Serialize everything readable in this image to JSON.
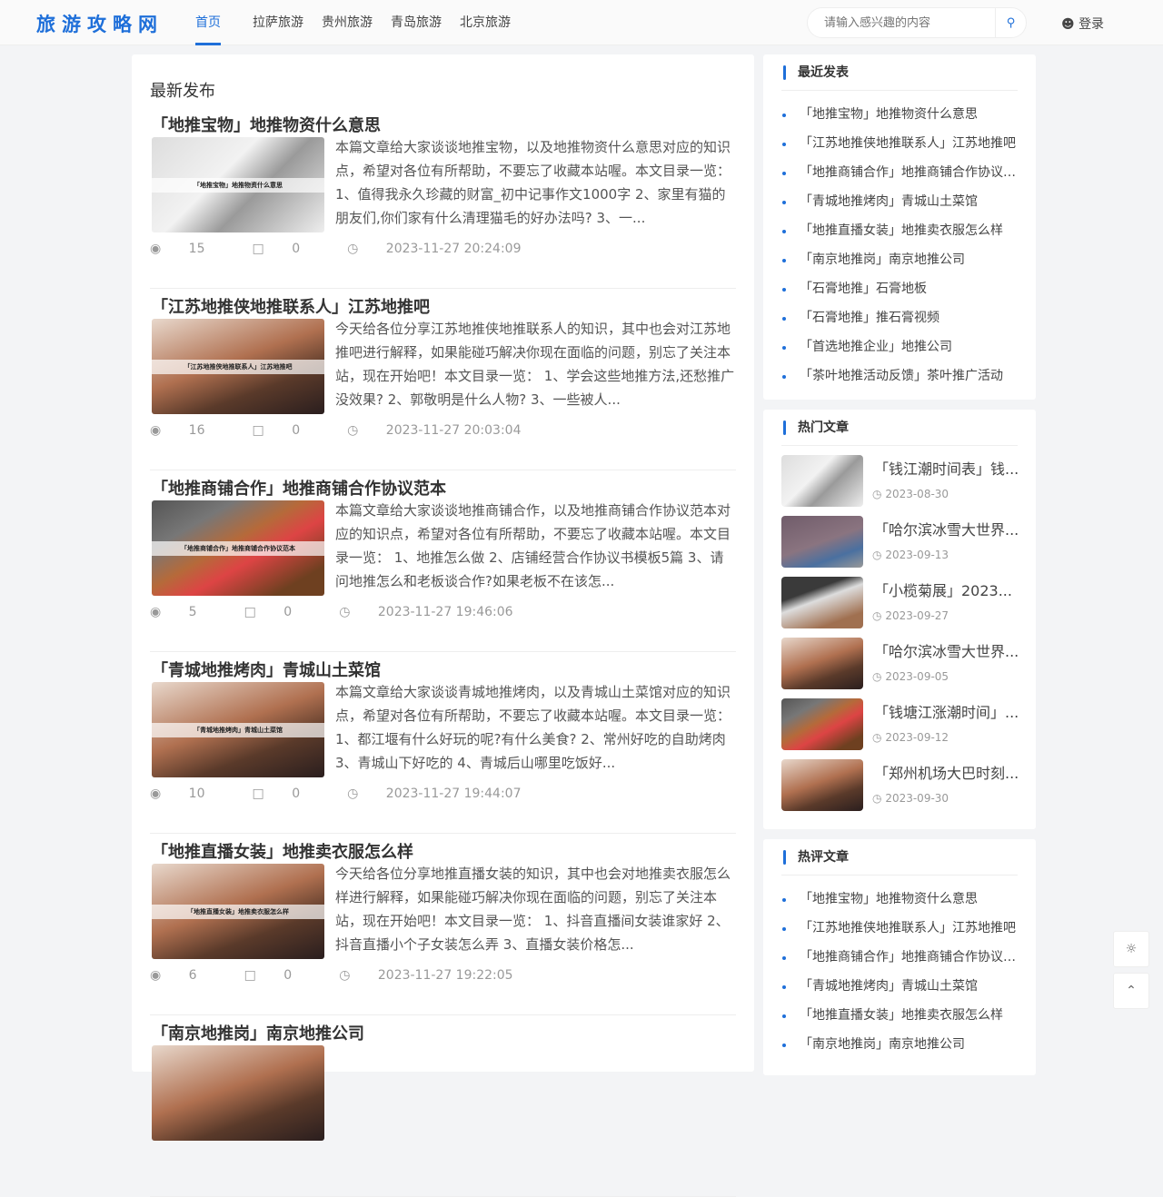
{
  "header": {
    "logo": "旅游攻略网",
    "nav": [
      "首页",
      "拉萨旅游",
      "贵州旅游",
      "青岛旅游",
      "北京旅游"
    ],
    "search_placeholder": "请输入感兴趣的内容",
    "login": "登录"
  },
  "main": {
    "heading": "最新发布",
    "articles": [
      {
        "title": "「地推宝物」地推物资什么意思",
        "thumb": "「地推宝物」地推物资什么意思",
        "desc": "本篇文章给大家谈谈地推宝物，以及地推物资什么意思对应的知识点，希望对各位有所帮助，不要忘了收藏本站喔。本文目录一览： 1、值得我永久珍藏的财富_初中记事作文1000字 2、家里有猫的朋友们,你们家有什么清理猫毛的好办法吗? 3、一...",
        "views": "15",
        "comments": "0",
        "time": "2023-11-27 20:24:09"
      },
      {
        "title": "「江苏地推侠地推联系人」江苏地推吧",
        "thumb": "「江苏地推侠地推联系人」江苏地推吧",
        "desc": "今天给各位分享江苏地推侠地推联系人的知识，其中也会对江苏地推吧进行解释，如果能碰巧解决你现在面临的问题，别忘了关注本站，现在开始吧！本文目录一览： 1、学会这些地推方法,还愁推广没效果? 2、郭敬明是什么人物? 3、一些被人...",
        "views": "16",
        "comments": "0",
        "time": "2023-11-27 20:03:04"
      },
      {
        "title": "「地推商铺合作」地推商铺合作协议范本",
        "thumb": "「地推商铺合作」地推商铺合作协议范本",
        "desc": "本篇文章给大家谈谈地推商铺合作，以及地推商铺合作协议范本对应的知识点，希望对各位有所帮助，不要忘了收藏本站喔。本文目录一览： 1、地推怎么做 2、店铺经营合作协议书模板5篇 3、请问地推怎么和老板谈合作?如果老板不在该怎...",
        "views": "5",
        "comments": "0",
        "time": "2023-11-27 19:46:06"
      },
      {
        "title": "「青城地推烤肉」青城山土菜馆",
        "thumb": "「青城地推烤肉」青城山土菜馆",
        "desc": "本篇文章给大家谈谈青城地推烤肉，以及青城山土菜馆对应的知识点，希望对各位有所帮助，不要忘了收藏本站喔。本文目录一览： 1、都江堰有什么好玩的呢?有什么美食? 2、常州好吃的自助烤肉 3、青城山下好吃的 4、青城后山哪里吃饭好...",
        "views": "10",
        "comments": "0",
        "time": "2023-11-27 19:44:07"
      },
      {
        "title": "「地推直播女装」地推卖衣服怎么样",
        "thumb": "「地推直播女装」地推卖衣服怎么样",
        "desc": "今天给各位分享地推直播女装的知识，其中也会对地推卖衣服怎么样进行解释，如果能碰巧解决你现在面临的问题，别忘了关注本站，现在开始吧！本文目录一览： 1、抖音直播间女装谁家好 2、抖音直播小个子女装怎么弄 3、直播女装价格怎...",
        "views": "6",
        "comments": "0",
        "time": "2023-11-27 19:22:05"
      },
      {
        "title": "「南京地推岗」南京地推公司",
        "thumb": "",
        "desc": "",
        "views": "",
        "comments": "",
        "time": ""
      }
    ]
  },
  "recent": {
    "title": "最近发表",
    "items": [
      "「地推宝物」地推物资什么意思",
      "「江苏地推侠地推联系人」江苏地推吧",
      "「地推商铺合作」地推商铺合作协议范本",
      "「青城地推烤肉」青城山土菜馆",
      "「地推直播女装」地推卖衣服怎么样",
      "「南京地推岗」南京地推公司",
      "「石膏地推」石膏地板",
      "「石膏地推」推石膏视频",
      "「首选地推企业」地推公司",
      "「茶叶地推活动反馈」茶叶推广活动"
    ]
  },
  "hot": {
    "title": "热门文章",
    "items": [
      {
        "title": "「钱江潮时间表」钱...",
        "date": "2023-08-30"
      },
      {
        "title": "「哈尔滨冰雪大世界...",
        "date": "2023-09-13"
      },
      {
        "title": "「小榄菊展」2023...",
        "date": "2023-09-27"
      },
      {
        "title": "「哈尔滨冰雪大世界...",
        "date": "2023-09-05"
      },
      {
        "title": "「钱塘江涨潮时间」...",
        "date": "2023-09-12"
      },
      {
        "title": "「郑州机场大巴时刻...",
        "date": "2023-09-30"
      }
    ]
  },
  "comments_hot": {
    "title": "热评文章",
    "items": [
      "「地推宝物」地推物资什么意思",
      "「江苏地推侠地推联系人」江苏地推吧",
      "「地推商铺合作」地推商铺合作协议范本",
      "「青城地推烤肉」青城山土菜馆",
      "「地推直播女装」地推卖衣服怎么样",
      "「南京地推岗」南京地推公司"
    ]
  },
  "icons": {
    "theme": "sun-icon",
    "top": "chevron-up-icon"
  },
  "colors": {
    "accent": "#1e6fd9"
  }
}
